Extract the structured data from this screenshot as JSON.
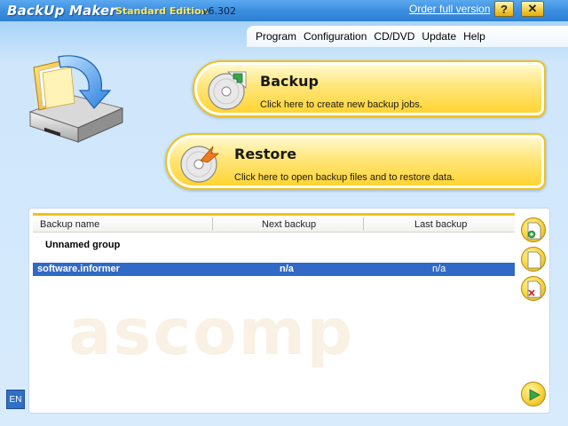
{
  "window": {
    "app_name": "BackUp Maker",
    "edition": "Standard Edition",
    "version": "v6.302",
    "order_link": "Order full version",
    "help_glyph": "?",
    "close_glyph": "✕"
  },
  "menu": [
    "Program",
    "Configuration",
    "CD/DVD",
    "Update",
    "Help"
  ],
  "actions": {
    "backup": {
      "title": "Backup",
      "description": "Click here to create new backup jobs."
    },
    "restore": {
      "title": "Restore",
      "description": "Click here to open backup files and to restore data."
    }
  },
  "jobs": {
    "columns": [
      "Backup name",
      "Next backup",
      "Last backup"
    ],
    "group": "Unnamed group",
    "rows": [
      {
        "name": "software.informer",
        "next": "n/a",
        "last": "n/a",
        "selected": true
      }
    ]
  },
  "watermark": "ascomp",
  "side_buttons": [
    "new-job-icon",
    "edit-job-icon",
    "delete-job-icon",
    "run-job-icon"
  ],
  "language": "EN",
  "colors": {
    "accent_yellow": "#ffd22c",
    "selection_blue": "#3169c6",
    "title_blue": "#3c8fe0"
  }
}
